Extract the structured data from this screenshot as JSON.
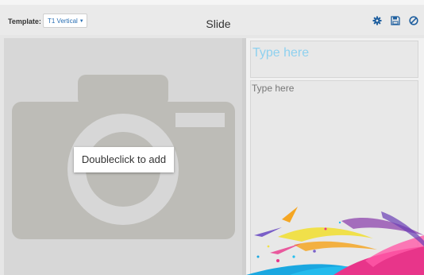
{
  "header": {
    "template_label": "Template:",
    "template_value": "T1 Vertical",
    "title": "Slide"
  },
  "toolbar": {
    "icons": [
      "gear-icon",
      "save-icon",
      "cancel-icon"
    ],
    "accent_color": "#2a6fb3"
  },
  "image_placeholder": {
    "button_label": "Doubleclick to add",
    "icon": "camera-icon"
  },
  "text_fields": {
    "title_placeholder": "Type here",
    "body_placeholder": "Type here",
    "title_color": "#8fd1ef"
  }
}
